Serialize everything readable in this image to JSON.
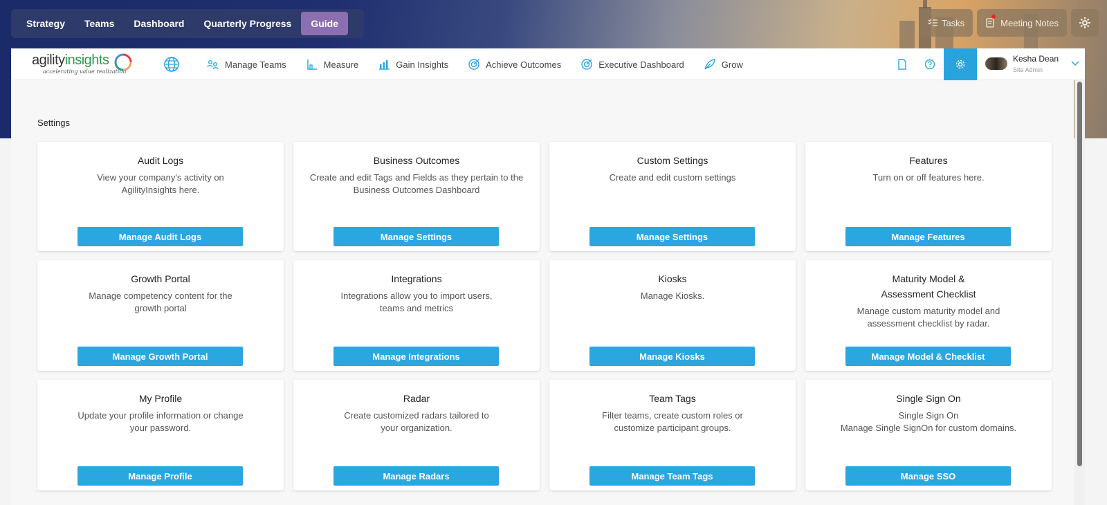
{
  "top_nav": {
    "items": [
      "Strategy",
      "Teams",
      "Dashboard",
      "Quarterly Progress",
      "Guide"
    ],
    "active": "Guide"
  },
  "top_right": {
    "tasks_label": "Tasks",
    "notes_label": "Meeting Notes"
  },
  "brand": {
    "name_part1": "agility",
    "name_part2": "insights",
    "tagline": "accelerating value realization"
  },
  "main_nav": [
    {
      "label": "Manage Teams",
      "icon": "teams-icon"
    },
    {
      "label": "Measure",
      "icon": "measure-icon"
    },
    {
      "label": "Gain Insights",
      "icon": "bar-chart-icon"
    },
    {
      "label": "Achieve Outcomes",
      "icon": "target-icon"
    },
    {
      "label": "Executive Dashboard",
      "icon": "target-icon"
    },
    {
      "label": "Grow",
      "icon": "leaf-icon"
    }
  ],
  "user": {
    "name": "Kesha Dean",
    "role": "Site Admin"
  },
  "page": {
    "title": "Settings"
  },
  "cards": [
    {
      "title": "Audit Logs",
      "desc": "View your company's activity on\nAgilityInsights here.",
      "button": "Manage Audit Logs"
    },
    {
      "title": "Business Outcomes",
      "desc": "Create and edit Tags and Fields as they pertain to the\nBusiness Outcomes Dashboard",
      "button": "Manage Settings"
    },
    {
      "title": "Custom Settings",
      "desc": "Create and edit custom settings",
      "button": "Manage Settings"
    },
    {
      "title": "Features",
      "desc": "Turn on or off features here.",
      "button": "Manage Features"
    },
    {
      "title": "Growth Portal",
      "desc": "Manage competency content for the\ngrowth portal",
      "button": "Manage Growth Portal"
    },
    {
      "title": "Integrations",
      "desc": "Integrations allow you to import users,\nteams and metrics",
      "button": "Manage Integrations"
    },
    {
      "title": "Kiosks",
      "desc": "Manage Kiosks.",
      "button": "Manage Kiosks"
    },
    {
      "title": "Maturity Model &\nAssessment Checklist",
      "desc": "Manage custom maturity model and\nassessment checklist by radar.",
      "button": "Manage Model & Checklist"
    },
    {
      "title": "My Profile",
      "desc": "Update your profile information or change\nyour password.",
      "button": "Manage Profile"
    },
    {
      "title": "Radar",
      "desc": "Create customized radars tailored to\nyour organization.",
      "button": "Manage Radars"
    },
    {
      "title": "Team Tags",
      "desc": "Filter teams, create custom roles or\ncustomize participant groups.",
      "button": "Manage Team Tags"
    },
    {
      "title": "Single Sign On",
      "desc": "Single Sign On\nManage Single SignOn for custom domains.",
      "button": "Manage SSO"
    }
  ],
  "colors": {
    "accent": "#2aa7e1",
    "active_tab": "#8c6fb0",
    "nav_bg": "#2d3a6a"
  }
}
